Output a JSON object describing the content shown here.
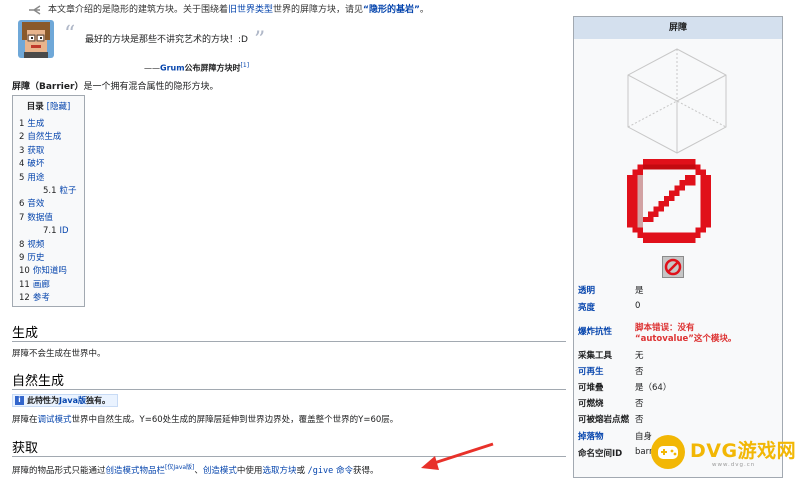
{
  "hatnote": {
    "prefix": "本文章介绍的是隐形的建筑方块。关于围绕着",
    "link1": "旧世界类型",
    "middle": "世界的屏障方块，请见",
    "link2": "“隐形的基岩”",
    "suffix": "。"
  },
  "quote": {
    "open": "“",
    "text": "最好的方块是那些不讲究艺术的方块！:D",
    "close": "”",
    "dash": "——",
    "author": "Grum",
    "author_suffix": "公布屏障方块时",
    "ref": "[1]"
  },
  "intro": {
    "term": "屏障（Barrier）",
    "text": "是一个拥有混合属性的隐形方块。"
  },
  "toc": {
    "title": "目录",
    "hide": "[隐藏]",
    "items": [
      {
        "num": "1",
        "label": "生成"
      },
      {
        "num": "2",
        "label": "自然生成"
      },
      {
        "num": "3",
        "label": "获取"
      },
      {
        "num": "4",
        "label": "破坏"
      },
      {
        "num": "5",
        "label": "用途"
      },
      {
        "num": "5.1",
        "label": "粒子"
      },
      {
        "num": "6",
        "label": "音效"
      },
      {
        "num": "7",
        "label": "数据值"
      },
      {
        "num": "7.1",
        "label": "ID"
      },
      {
        "num": "8",
        "label": "视频"
      },
      {
        "num": "9",
        "label": "历史"
      },
      {
        "num": "10",
        "label": "你知道吗"
      },
      {
        "num": "11",
        "label": "画廊"
      },
      {
        "num": "12",
        "label": "参考"
      }
    ]
  },
  "sections": {
    "gen_title": "生成",
    "gen_text": "屏障不会生成在世界中。",
    "natural_title": "自然生成",
    "notice_text_a": "此特性为",
    "notice_link": "Java版",
    "notice_text_b": "独有。",
    "natural_pre": "屏障在",
    "natural_link": "调试模式",
    "natural_post": "世界中自然生成。Y=60处生成的屏障层延伸到世界边界处，覆盖整个世界的Y=60层。",
    "obtain_title": "获取",
    "obtain_pre": "屏障的物品形式只能通过",
    "obtain_link1": "创造模式物品栏",
    "obtain_sup": "[仅Java版]",
    "obtain_mid1": "、",
    "obtain_link2": "创造模式",
    "obtain_mid2": "中使用",
    "obtain_link3": "选取方块",
    "obtain_mid3": "或 ",
    "obtain_code": "/give",
    "obtain_link4": " 命令",
    "obtain_end": "获得。"
  },
  "infobox": {
    "title": "屏障",
    "rows": [
      {
        "label": "透明",
        "value": "是"
      },
      {
        "label": "亮度",
        "value": "0"
      },
      {
        "label": "爆炸抗性",
        "value": "脚本错误：没有",
        "value2": "“autovalue”这个模块。"
      },
      {
        "label": "采集工具",
        "value": "无"
      },
      {
        "label": "可再生",
        "value": "否"
      },
      {
        "label": "可堆叠",
        "value": "是（64）"
      },
      {
        "label": "可燃烧",
        "value": "否"
      },
      {
        "label": "可被熔岩点燃",
        "value": "否"
      },
      {
        "label": "掉落物",
        "value": "自身"
      },
      {
        "label": "命名空间ID",
        "value": "barrier"
      }
    ]
  },
  "watermark": {
    "text": "DVG游戏网",
    "sub": "www.dvg.cn"
  },
  "colors": {
    "link": "#0645ad",
    "error": "#dd3333",
    "barrier_red": "#e0101a",
    "arrow": "#e8312a",
    "watermark": "#f2b705"
  }
}
